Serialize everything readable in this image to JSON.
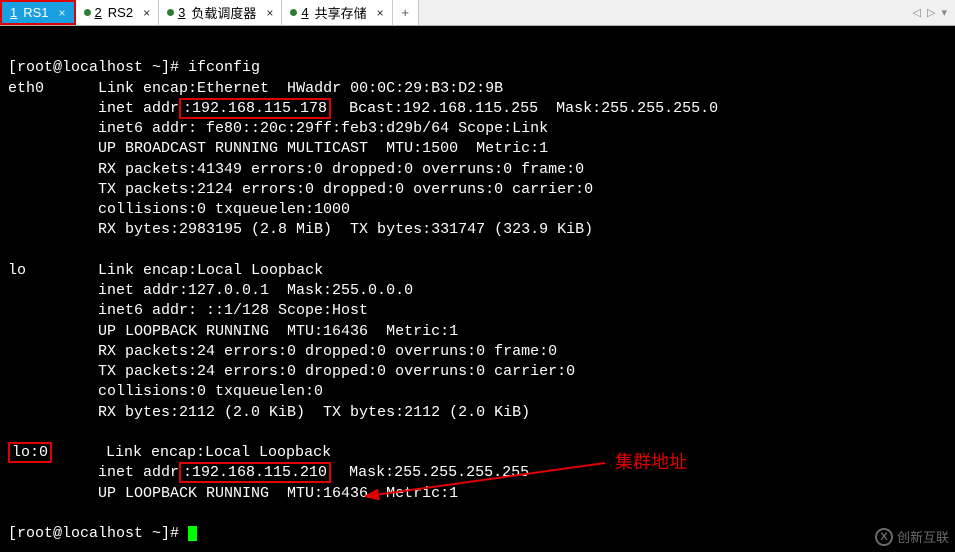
{
  "tabs": {
    "items": [
      {
        "num": "1",
        "label": "RS1",
        "active": true
      },
      {
        "num": "2",
        "label": "RS2",
        "active": false
      },
      {
        "num": "3",
        "label": "负载调度器",
        "active": false
      },
      {
        "num": "4",
        "label": "共享存储",
        "active": false
      }
    ],
    "add_label": "+",
    "scroll_left": "◁",
    "scroll_right": "▷",
    "scroll_menu": "▾"
  },
  "prompt": {
    "text": "[root@localhost ~]# ",
    "cmd": "ifconfig",
    "end": "[root@localhost ~]# "
  },
  "ifconfig": {
    "eth0": {
      "name": "eth0",
      "l1a": "Link encap:Ethernet  HWaddr 00:0C:29:B3:D2:9B",
      "l2a": "inet addr",
      "l2ip": ":192.168.115.178",
      "l2b": "  Bcast:192.168.115.255  Mask:255.255.255.0",
      "l3": "inet6 addr: fe80::20c:29ff:feb3:d29b/64 Scope:Link",
      "l4": "UP BROADCAST RUNNING MULTICAST  MTU:1500  Metric:1",
      "l5": "RX packets:41349 errors:0 dropped:0 overruns:0 frame:0",
      "l6": "TX packets:2124 errors:0 dropped:0 overruns:0 carrier:0",
      "l7": "collisions:0 txqueuelen:1000",
      "l8": "RX bytes:2983195 (2.8 MiB)  TX bytes:331747 (323.9 KiB)"
    },
    "lo": {
      "name": "lo",
      "l1": "Link encap:Local Loopback",
      "l2": "inet addr:127.0.0.1  Mask:255.0.0.0",
      "l3": "inet6 addr: ::1/128 Scope:Host",
      "l4": "UP LOOPBACK RUNNING  MTU:16436  Metric:1",
      "l5": "RX packets:24 errors:0 dropped:0 overruns:0 frame:0",
      "l6": "TX packets:24 errors:0 dropped:0 overruns:0 carrier:0",
      "l7": "collisions:0 txqueuelen:0",
      "l8": "RX bytes:2112 (2.0 KiB)  TX bytes:2112 (2.0 KiB)"
    },
    "lo0": {
      "name": "lo:0",
      "l1": "Link encap:Local Loopback",
      "l2a": "inet addr",
      "l2ip": ":192.168.115.210",
      "l2b": "  Mask:255.255.255.255",
      "l3": "UP LOOPBACK RUNNING  MTU:16436  Metric:1"
    }
  },
  "annotation": {
    "text": "集群地址"
  },
  "watermark": {
    "logo_glyph": "X",
    "text": "创新互联"
  }
}
